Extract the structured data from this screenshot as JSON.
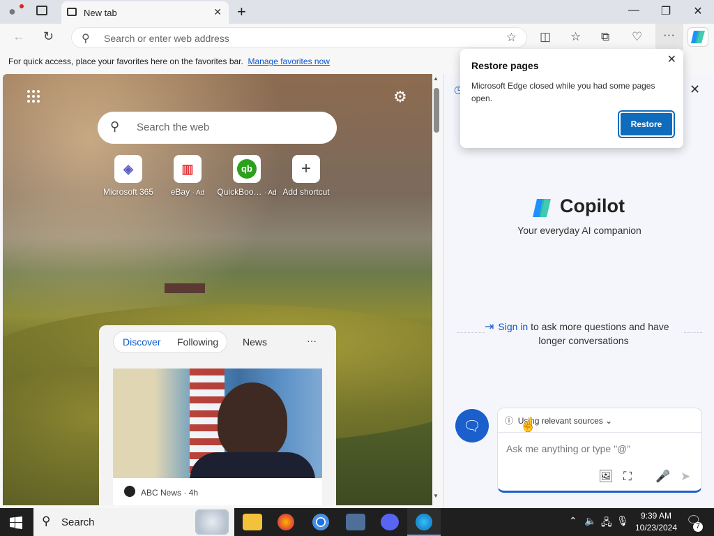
{
  "window": {
    "tab_title": "New tab",
    "new_tab_symbol": "+",
    "min_symbol": "—",
    "restore_symbol": "❐",
    "close_symbol": "✕"
  },
  "toolbar": {
    "address_placeholder": "Search or enter web address"
  },
  "favorites_bar": {
    "text": "For quick access, place your favorites here on the favorites bar.",
    "link": "Manage favorites now"
  },
  "ntp": {
    "search_placeholder": "Search the web",
    "shortcuts": [
      {
        "label": "Microsoft 365",
        "ad": "",
        "glyph": "◈",
        "color": "#5b5fc7"
      },
      {
        "label": "eBay",
        "ad": "· Ad",
        "glyph": "▥",
        "color": "#e53238"
      },
      {
        "label": "QuickBoo…",
        "ad": "· Ad",
        "glyph": "qb",
        "color": "#2ca01c"
      },
      {
        "label": "Add shortcut",
        "ad": "",
        "glyph": "+",
        "color": "#444444"
      }
    ],
    "feed": {
      "tabs": [
        "Discover",
        "Following",
        "News"
      ],
      "more": "···",
      "card_source": "ABC News",
      "card_time": "· 4h"
    }
  },
  "restore_popup": {
    "title": "Restore pages",
    "body": "Microsoft Edge closed while you had some pages open.",
    "button": "Restore"
  },
  "copilot": {
    "title": "Copilot",
    "subtitle": "Your everyday AI companion",
    "signin_link": "Sign in",
    "signin_text": "to ask more questions and have longer conversations",
    "sources": "Using relevant sources",
    "input_placeholder": "Ask me anything or type \"@\""
  },
  "taskbar": {
    "search_label": "Search",
    "time": "9:39 AM",
    "date": "10/23/2024",
    "notification_count": "7"
  }
}
